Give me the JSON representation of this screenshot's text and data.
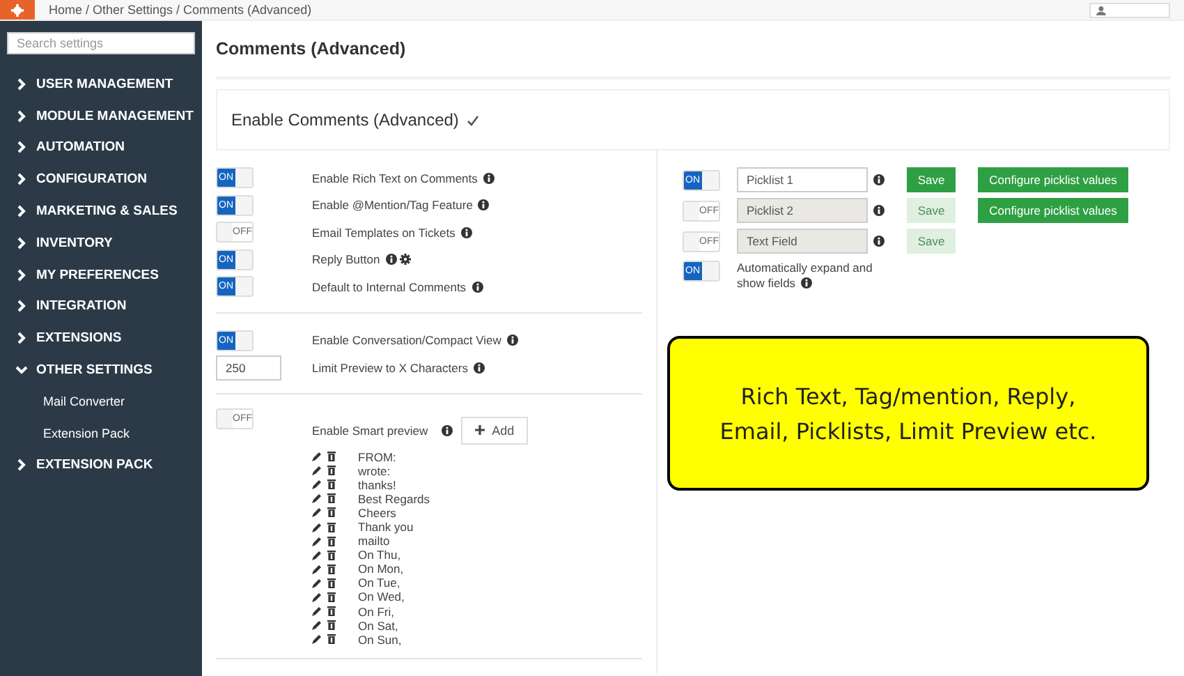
{
  "header": {
    "breadcrumb": "Home / Other Settings / Comments (Advanced)"
  },
  "sidebar": {
    "search": {
      "placeholder": "Search settings"
    },
    "items": [
      {
        "label": "USER MANAGEMENT",
        "expanded": false
      },
      {
        "label": "MODULE MANAGEMENT",
        "expanded": false
      },
      {
        "label": "AUTOMATION",
        "expanded": false
      },
      {
        "label": "CONFIGURATION",
        "expanded": false
      },
      {
        "label": "MARKETING & SALES",
        "expanded": false
      },
      {
        "label": "INVENTORY",
        "expanded": false
      },
      {
        "label": "MY PREFERENCES",
        "expanded": false
      },
      {
        "label": "INTEGRATION",
        "expanded": false
      },
      {
        "label": "EXTENSIONS",
        "expanded": false
      },
      {
        "label": "OTHER SETTINGS",
        "expanded": true,
        "children": [
          {
            "label": "Mail Converter"
          },
          {
            "label": "Extension Pack"
          }
        ]
      },
      {
        "label": "EXTENSION PACK",
        "expanded": false
      }
    ]
  },
  "page_title": "Comments (Advanced)",
  "enable_panel": {
    "title": "Enable Comments (Advanced)",
    "checked": true
  },
  "setting_groups": [
    [
      {
        "kind": "toggle",
        "on": true,
        "switch_text": "ON",
        "label": "Enable Rich Text on Comments",
        "gear": false
      },
      {
        "kind": "toggle",
        "on": true,
        "switch_text": "ON",
        "label": "Enable @Mention/Tag Feature",
        "gear": false
      },
      {
        "kind": "toggle",
        "on": false,
        "switch_text": "OFF",
        "label": "Email Templates on Tickets",
        "gear": false
      },
      {
        "kind": "toggle",
        "on": true,
        "switch_text": "ON",
        "label": "Reply Button",
        "gear": true
      },
      {
        "kind": "toggle",
        "on": true,
        "switch_text": "ON",
        "label": "Default to Internal Comments",
        "gear": false
      }
    ],
    [
      {
        "kind": "toggle",
        "on": true,
        "switch_text": "ON",
        "label": "Enable Conversation/Compact View",
        "gear": false
      },
      {
        "kind": "number",
        "value": "250",
        "label": "Limit Preview to X Characters"
      }
    ]
  ],
  "smart_preview": {
    "on": false,
    "switch_text": "OFF",
    "label": "Enable Smart preview",
    "add_button": "Add",
    "phrases": [
      "FROM:",
      "wrote:",
      "thanks!",
      "Best Regards",
      "Cheers",
      "Thank you",
      "mailto",
      "On Thu,",
      "On Mon,",
      "On Tue,",
      "On Wed,",
      "On Fri,",
      "On Sat,",
      "On Sun,"
    ]
  },
  "fields": [
    {
      "on": true,
      "switch_text": "ON",
      "value": "Picklist 1",
      "disabled": false,
      "save": "Save",
      "configure": "Configure picklist values"
    },
    {
      "on": false,
      "switch_text": "OFF",
      "value": "Picklist 2",
      "disabled": true,
      "save": "Save",
      "configure": "Configure picklist values"
    },
    {
      "on": false,
      "switch_text": "OFF",
      "value": "Text Field",
      "disabled": true,
      "save": "Save"
    }
  ],
  "auto_expand": {
    "on": true,
    "switch_text": "ON",
    "label": "Automatically expand and show fields"
  },
  "callout": {
    "lines": [
      "Rich Text, Tag/mention, Reply,",
      "Email, Picklists, Limit Preview etc."
    ]
  }
}
